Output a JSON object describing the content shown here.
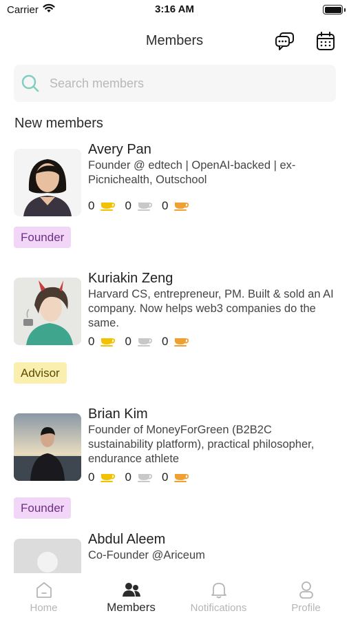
{
  "status_bar": {
    "carrier": "Carrier",
    "time": "3:16 AM"
  },
  "header": {
    "title": "Members",
    "chat_icon": "chat-bubbles-icon",
    "calendar_icon": "calendar-icon"
  },
  "search": {
    "placeholder": "Search members",
    "value": ""
  },
  "section": {
    "title": "New members"
  },
  "members": [
    {
      "name": "Avery Pan",
      "bio": "Founder @ edtech | OpenAI-backed | ex-Picnichealth, Outschool",
      "gold": "0",
      "silver": "0",
      "bronze": "0",
      "tag": "Founder"
    },
    {
      "name": "Kuriakin Zeng",
      "bio": "Harvard CS, entrepreneur, PM. Built & sold an AI company. Now helps web3 companies do the same.",
      "gold": "0",
      "silver": "0",
      "bronze": "0",
      "tag": "Advisor"
    },
    {
      "name": "Brian Kim",
      "bio": "Founder of MoneyForGreen (B2B2C sustainability platform), practical philosopher, endurance athlete",
      "gold": "0",
      "silver": "0",
      "bronze": "0",
      "tag": "Founder"
    },
    {
      "name": "Abdul Aleem",
      "bio": "Co-Founder @Ariceum"
    }
  ],
  "tabs": [
    {
      "label": "Home",
      "icon": "home-icon"
    },
    {
      "label": "Members",
      "icon": "members-icon",
      "active": true
    },
    {
      "label": "Notifications",
      "icon": "bell-icon"
    },
    {
      "label": "Profile",
      "icon": "profile-icon"
    }
  ],
  "colors": {
    "accent_search": "#7fcfc0",
    "gold": "#f2c200",
    "silver": "#c8c8c8",
    "bronze": "#f0a030",
    "founder_tag": "#f1d6f8",
    "advisor_tag": "#fbefb0"
  }
}
